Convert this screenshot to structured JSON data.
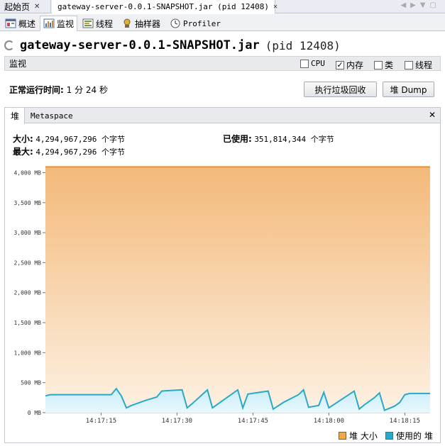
{
  "tabs": [
    {
      "label": "起始页",
      "active": false
    },
    {
      "label": "gateway-server-0.0.1-SNAPSHOT.jar (pid 12408)",
      "active": true
    }
  ],
  "view_tabs": [
    {
      "label": "概述",
      "icon": "overview-icon"
    },
    {
      "label": "监视",
      "icon": "monitor-icon",
      "active": true
    },
    {
      "label": "线程",
      "icon": "threads-icon"
    },
    {
      "label": "抽样器",
      "icon": "sampler-icon"
    },
    {
      "label": "Profiler",
      "icon": "profiler-icon"
    }
  ],
  "header": {
    "title": "gateway-server-0.0.1-SNAPSHOT.jar",
    "pid": "(pid 12408)"
  },
  "monitor": {
    "label": "监视",
    "checkboxes": [
      {
        "label": "CPU",
        "checked": false
      },
      {
        "label": "内存",
        "checked": true
      },
      {
        "label": "类",
        "checked": false
      },
      {
        "label": "线程",
        "checked": false
      }
    ]
  },
  "uptime": {
    "label": "正常运行时间:",
    "value": "1 分 24 秒"
  },
  "buttons": {
    "gc": "执行垃圾回收",
    "dump": "堆 Dump"
  },
  "panel": {
    "tabs": [
      {
        "label": "堆",
        "active": true
      },
      {
        "label": "Metaspace"
      }
    ],
    "size_label": "大小:",
    "size_value": "4,294,967,296 个字节",
    "max_label": "最大:",
    "max_value": "4,294,967,296 个字节",
    "used_label": "已使用:",
    "used_value": "351,814,344 个字节"
  },
  "colors": {
    "heap_size": "#f0a848",
    "used_heap": "#2aa8c8"
  },
  "chart_data": {
    "type": "area",
    "ylim": [
      0,
      4100
    ],
    "yticks": [
      0,
      500,
      1000,
      1500,
      2000,
      2500,
      3000,
      3500,
      4000
    ],
    "ytick_labels": [
      "0 MB",
      "500 MB",
      "1,000 MB",
      "1,500 MB",
      "2,000 MB",
      "2,500 MB",
      "3,000 MB",
      "3,500 MB",
      "4,000 MB"
    ],
    "x_range": [
      "14:17:04",
      "14:18:20"
    ],
    "xticks": [
      "14:17:15",
      "14:17:30",
      "14:17:45",
      "14:18:00",
      "14:18:15"
    ],
    "series": [
      {
        "name": "堆 大小",
        "x": [
          "14:17:04",
          "14:18:20"
        ],
        "values": [
          4096,
          4096
        ]
      },
      {
        "name": "使用的 堆",
        "x": [
          "14:17:04",
          "14:17:05",
          "14:17:13",
          "14:17:17",
          "14:17:18",
          "14:17:19",
          "14:17:20",
          "14:17:21",
          "14:17:24",
          "14:17:26",
          "14:17:27",
          "14:17:31",
          "14:17:32",
          "14:17:33",
          "14:17:36",
          "14:17:37",
          "14:17:42",
          "14:17:43",
          "14:17:44",
          "14:17:48",
          "14:17:49",
          "14:17:51",
          "14:17:54",
          "14:17:55",
          "14:17:56",
          "14:17:58",
          "14:17:59",
          "14:18:00",
          "14:18:05",
          "14:18:06",
          "14:18:07",
          "14:18:09",
          "14:18:10",
          "14:18:11",
          "14:18:13",
          "14:18:14",
          "14:18:15",
          "14:18:16",
          "14:18:20"
        ],
        "values": [
          280,
          300,
          300,
          300,
          400,
          280,
          80,
          120,
          210,
          260,
          360,
          380,
          80,
          150,
          380,
          80,
          380,
          80,
          310,
          360,
          60,
          170,
          300,
          380,
          90,
          120,
          340,
          80,
          360,
          60,
          130,
          250,
          330,
          40,
          110,
          170,
          300,
          320,
          320
        ]
      }
    ]
  },
  "legend": [
    {
      "label": "堆 大小"
    },
    {
      "label": "使用的 堆"
    }
  ]
}
